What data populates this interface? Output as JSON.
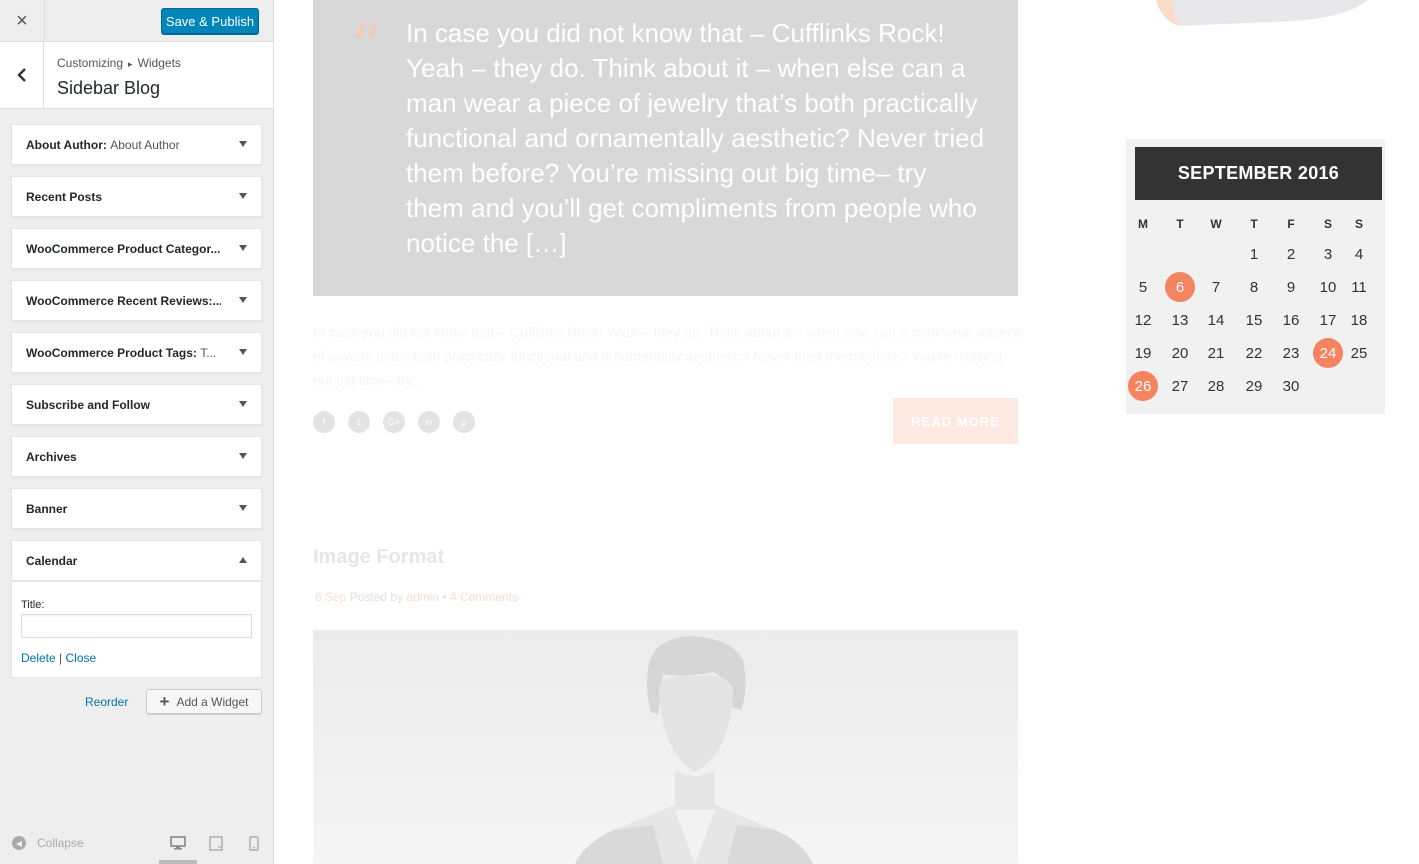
{
  "customizer": {
    "close_icon": "×",
    "publish_label": "Save & Publish",
    "breadcrumb": [
      "Customizing",
      "Widgets"
    ],
    "breadcrumb_sep": "▸",
    "section_title": "Sidebar Blog",
    "widgets": [
      {
        "title": "About Author",
        "subtitle": "About Author",
        "expanded": false
      },
      {
        "title": "Recent Posts",
        "subtitle": "",
        "expanded": false
      },
      {
        "title": "WooCommerce Product Categor...",
        "subtitle": "",
        "expanded": false
      },
      {
        "title": "WooCommerce Recent Reviews:...",
        "subtitle": "",
        "expanded": false
      },
      {
        "title": "WooCommerce Product Tags:",
        "subtitle": "T...",
        "expanded": false
      },
      {
        "title": "Subscribe and Follow",
        "subtitle": "",
        "expanded": false
      },
      {
        "title": "Archives",
        "subtitle": "",
        "expanded": false
      },
      {
        "title": "Banner",
        "subtitle": "",
        "expanded": false
      },
      {
        "title": "Calendar",
        "subtitle": "",
        "expanded": true
      }
    ],
    "calendar_widget": {
      "title_label": "Title:",
      "title_value": "",
      "delete_label": "Delete",
      "separator": "|",
      "close_label": "Close"
    },
    "reorder_label": "Reorder",
    "add_widget_label": "Add a Widget",
    "collapse_label": "Collapse",
    "devices": [
      "desktop-icon",
      "tablet-icon",
      "mobile-icon"
    ],
    "active_device": "desktop"
  },
  "preview": {
    "quote_text": "In case you did not know that  – Cufflinks Rock! Yeah – they do. Think about it – when else can a man wear a piece of jewelry that’s both practically functional and ornamentally aesthetic? Never tried them before? You’re missing out big time– try them and you’ll get compliments from people who notice the […]",
    "excerpt": "In case you did not know that  – Cufflinks Rock! Yeah – they do. Think about it – when else can a man wear a piece of jewelry that’s both practically functional and ornamentally aesthetic? Never tried them before? You’re missing out big time– try...",
    "share_icons": [
      {
        "name": "facebook-icon",
        "glyph": "f"
      },
      {
        "name": "twitter-icon",
        "glyph": "t"
      },
      {
        "name": "google-plus-icon",
        "glyph": "G+"
      },
      {
        "name": "linkedin-icon",
        "glyph": "in"
      },
      {
        "name": "pinterest-icon",
        "glyph": "p"
      }
    ],
    "read_more": "READ MORE",
    "post2": {
      "title": "Image Format",
      "date": "6 Sep",
      "posted_by": "Posted by",
      "author": "admin",
      "dot": "•",
      "comments": "4 Comments"
    },
    "calendar": {
      "month": "SEPTEMBER 2016",
      "weekdays": [
        "M",
        "T",
        "W",
        "T",
        "F",
        "S",
        "S"
      ],
      "weeks": [
        [
          "",
          "",
          "",
          "1",
          "2",
          "3",
          "4"
        ],
        [
          "5",
          "6",
          "7",
          "8",
          "9",
          "10",
          "11"
        ],
        [
          "12",
          "13",
          "14",
          "15",
          "16",
          "17",
          "18"
        ],
        [
          "19",
          "20",
          "21",
          "22",
          "23",
          "24",
          "25"
        ],
        [
          "26",
          "27",
          "28",
          "29",
          "30",
          "",
          ""
        ]
      ],
      "highlighted": [
        "6",
        "24",
        "26"
      ],
      "highlight_color": "#f4845f"
    }
  }
}
